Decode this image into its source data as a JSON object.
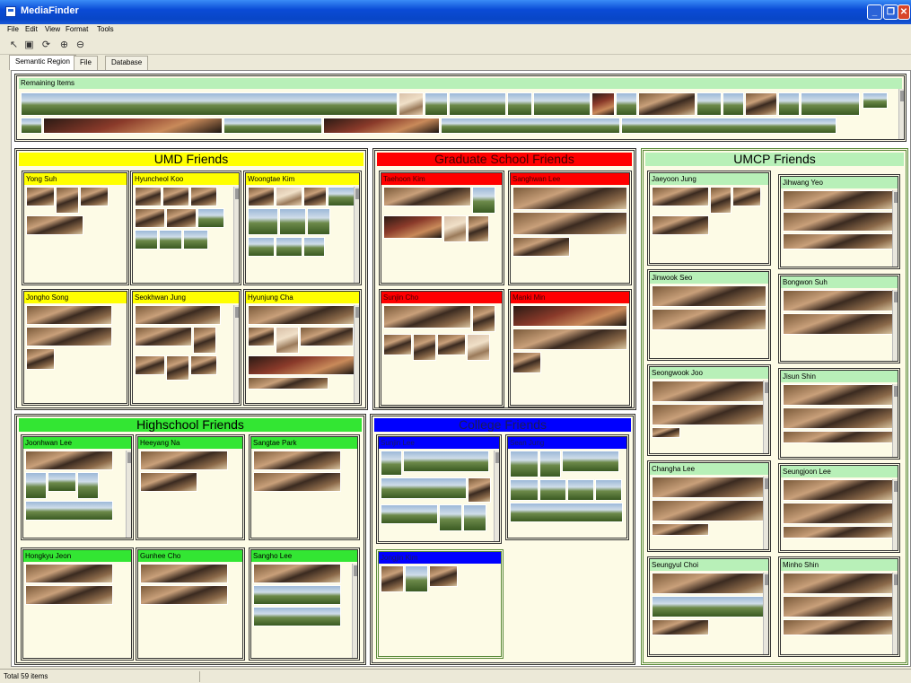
{
  "window": {
    "title": "MediaFinder"
  },
  "menu": [
    "File",
    "Edit",
    "View",
    "Format",
    "Tools"
  ],
  "toolbar": [
    {
      "icon": "pointer-icon",
      "glyph": "↖"
    },
    {
      "icon": "save-icon",
      "glyph": "▣"
    },
    {
      "icon": "refresh-icon",
      "glyph": "⟳"
    },
    {
      "icon": "zoom-in-icon",
      "glyph": "⊕"
    },
    {
      "icon": "zoom-out-icon",
      "glyph": "⊖"
    }
  ],
  "tabs": [
    "Semantic Region",
    "File",
    "Database"
  ],
  "remaining": {
    "title": "Remaining Items"
  },
  "regions": {
    "umd": {
      "title": "UMD Friends",
      "people": [
        "Yong Suh",
        "Hyuncheol Koo",
        "Woongtae Kim",
        "Jongho Song",
        "Seokhwan Jung",
        "Hyunjung Cha"
      ]
    },
    "grad": {
      "title": "Graduate School Friends",
      "people": [
        "Taehoon Kim",
        "Sanghwan Lee",
        "Sunjin Cho",
        "Manki Min"
      ]
    },
    "umcp": {
      "title": "UMCP Friends",
      "people": [
        "Jaeyoon Jung",
        "Jihwang Yeo",
        "Jinwook Seo",
        "Bongwon Suh",
        "Seongwook Joo",
        "Jisun Shin",
        "Changha Lee",
        "Seungjoon Lee",
        "Seungyul Choi",
        "Minho Shin"
      ]
    },
    "high": {
      "title": "Highschool Friends",
      "people": [
        "Joonhwan Lee",
        "Heeyang Na",
        "Sangtae Park",
        "Hongkyu Jeon",
        "Gunhee Cho",
        "Sangho Lee"
      ]
    },
    "college": {
      "title": "College Friends",
      "people": [
        "Sunjin Lee",
        "Sean Jung",
        "Jongjin Kim"
      ]
    }
  },
  "status": {
    "text": "Total 59 items"
  },
  "colors": {
    "umd": "#ffff00",
    "grad": "#ff0000",
    "umcp": "#b8f0b8",
    "high": "#33e633",
    "college": "#0000ff"
  }
}
